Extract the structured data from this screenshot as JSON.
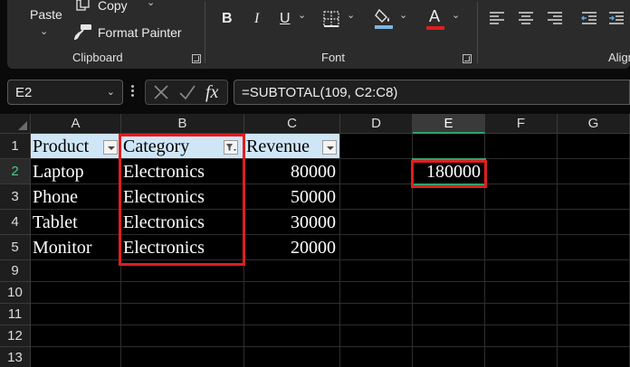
{
  "ribbon": {
    "clipboard": {
      "paste_label": "Paste",
      "copy_label": "Copy",
      "format_painter_label": "Format Painter",
      "group_label": "Clipboard"
    },
    "font": {
      "bold": "B",
      "italic": "I",
      "underline": "U",
      "font_color_glyph": "A",
      "group_label": "Font",
      "fill_color": "#7fb5e0",
      "font_color": "#e01e1e"
    },
    "alignment": {
      "group_label": "Align"
    }
  },
  "formula_bar": {
    "name_box": "E2",
    "fx_label": "fx",
    "formula": "=SUBTOTAL(109, C2:C8)"
  },
  "sheet": {
    "columns": [
      "A",
      "B",
      "C",
      "D",
      "E",
      "F",
      "G"
    ],
    "rows": [
      "1",
      "2",
      "3",
      "4",
      "5",
      "9",
      "10",
      "11",
      "12",
      "13"
    ],
    "selected_column": "E",
    "selected_row": "2",
    "headers": {
      "product": "Product",
      "category": "Category",
      "revenue": "Revenue"
    },
    "data": [
      {
        "product": "Laptop",
        "category": "Electronics",
        "revenue": "80000"
      },
      {
        "product": "Phone",
        "category": "Electronics",
        "revenue": "50000"
      },
      {
        "product": "Tablet",
        "category": "Electronics",
        "revenue": "30000"
      },
      {
        "product": "Monitor",
        "category": "Electronics",
        "revenue": "20000"
      }
    ],
    "result_cell_value": "180000",
    "highlight_color": "#e01e1e",
    "header_fill": "#cfe6f7",
    "selection_color": "#2ea36a"
  }
}
